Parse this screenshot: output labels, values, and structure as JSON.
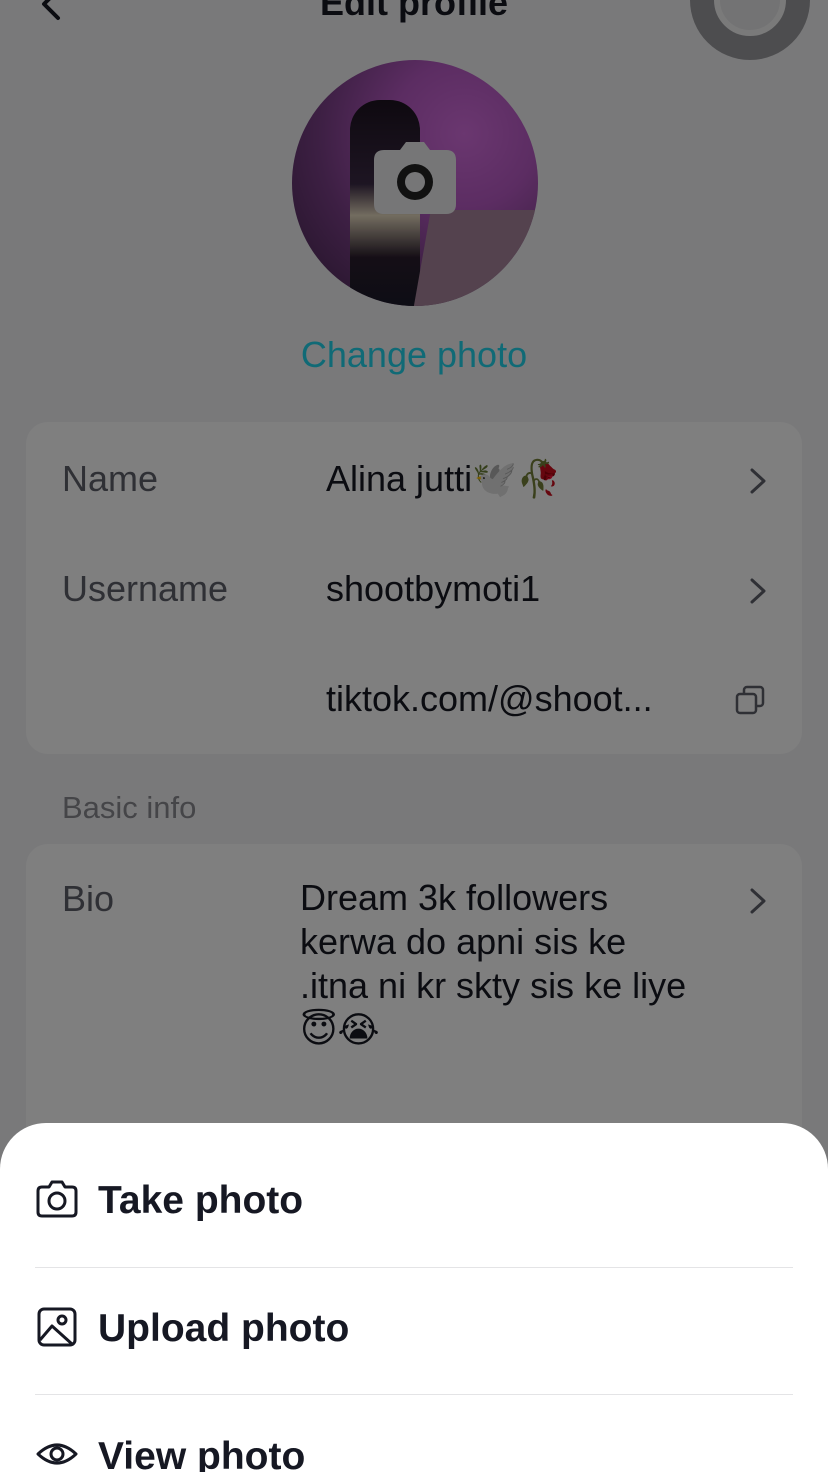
{
  "header": {
    "title": "Edit profile"
  },
  "avatar": {
    "change_photo_label": "Change photo"
  },
  "profile": {
    "name_label": "Name",
    "name_value": "Alina jutti🕊️🥀",
    "username_label": "Username",
    "username_value": "shootbymoti1",
    "link_value": "tiktok.com/@shoot..."
  },
  "basic_info": {
    "section_label": "Basic info",
    "bio_label": "Bio",
    "bio_value": "Dream 3k followers kerwa do apni sis ke .itna ni kr skty sis ke liye 😇😭"
  },
  "sheet": {
    "items": [
      {
        "label": "Take photo",
        "icon": "camera-icon"
      },
      {
        "label": "Upload photo",
        "icon": "image-icon"
      },
      {
        "label": "View photo",
        "icon": "eye-icon"
      }
    ]
  },
  "colors": {
    "accent": "#20d5ec",
    "text_primary": "#161823",
    "text_secondary": "#5f606a",
    "overlay": "rgba(0,0,0,0.5)"
  }
}
